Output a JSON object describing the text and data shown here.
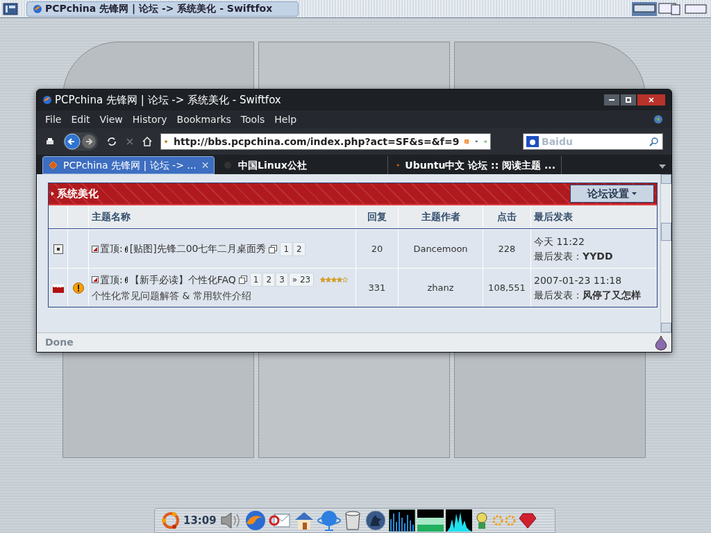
{
  "taskbar": {
    "window_button": {
      "title": "PCPchina 先锋网 | 论坛 -> 系统美化 - Swiftfox",
      "selected": true
    }
  },
  "window": {
    "title": "PCPchina 先锋网 | 论坛 -> 系统美化 - Swiftfox",
    "menu": [
      "File",
      "Edit",
      "View",
      "History",
      "Bookmarks",
      "Tools",
      "Help"
    ],
    "url": "http://bbs.pcpchina.com/index.php?act=SF&s=&f=9",
    "search_placeholder": "Baidu",
    "tabs": [
      {
        "label": "PCPchina 先锋网 | 论坛 -> ...",
        "selected": true
      },
      {
        "label": "中国Linux公社",
        "selected": false
      },
      {
        "label": "Ubuntu中文 论坛 :: 阅读主题 ...",
        "selected": false
      }
    ],
    "forum": {
      "section_title": "系统美化",
      "settings_button": "论坛设置",
      "columns": [
        "主题名称",
        "回复",
        "主题作者",
        "点击",
        "最后发表"
      ],
      "rows": [
        {
          "kind": "pinned",
          "alert": false,
          "prefix": "置顶:",
          "title": "[贴图]先锋二00七年二月桌面秀",
          "pages": [
            "1",
            "2"
          ],
          "description": "",
          "replies": "20",
          "author": "Dancemoon",
          "views": "228",
          "last_time": "今天 11:22",
          "last_label": "最后发表：",
          "last_author": "YYDD"
        },
        {
          "kind": "hot",
          "alert": true,
          "prefix": "置顶:",
          "title": "【新手必读】个性化FAQ",
          "pages": [
            "1",
            "2",
            "3",
            "» 23"
          ],
          "stars": 4,
          "description": "个性化常见问题解答 & 常用软件介绍",
          "replies": "331",
          "author": "zhanz",
          "views": "108,551",
          "last_time": "2007-01-23 11:18",
          "last_label": "最后发表：",
          "last_author": "风停了又怎样"
        }
      ]
    },
    "status": "Done"
  },
  "dock": {
    "clock": "13:09"
  }
}
